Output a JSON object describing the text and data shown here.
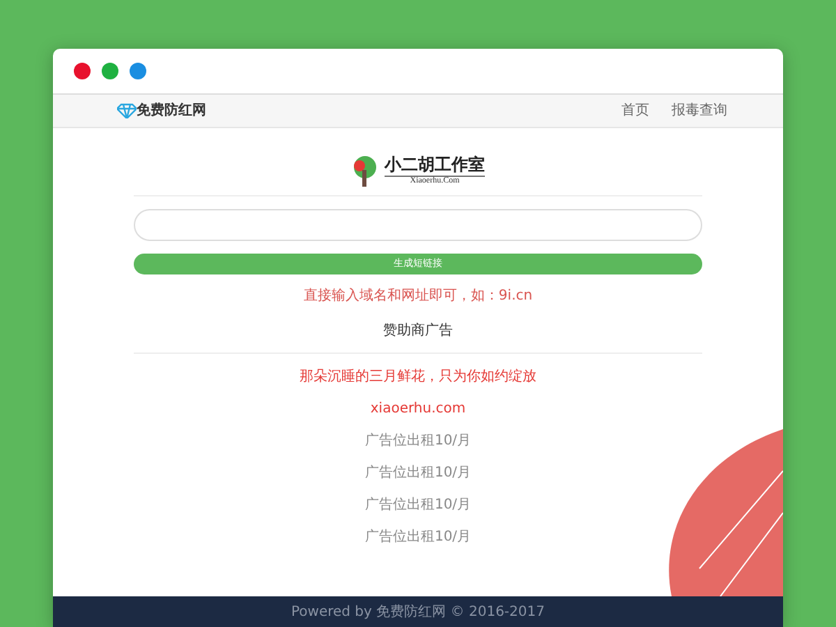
{
  "brand": {
    "name": "免费防红网"
  },
  "nav": [
    {
      "label": "首页"
    },
    {
      "label": "报毒查询"
    }
  ],
  "logo": {
    "title": "小二胡工作室",
    "subtitle": "Xiaoerhu.Com"
  },
  "generate_button": {
    "label": "生成短链接"
  },
  "hint": "直接输入域名和网址即可，如：9i.cn",
  "sponsor_heading": "赞助商广告",
  "ads": [
    {
      "kind": "slogan",
      "text": "那朵沉睡的三月鲜花，只为你如约绽放"
    },
    {
      "kind": "link",
      "text": "xiaoerhu.com"
    },
    {
      "kind": "plain",
      "text": "广告位出租10/月"
    },
    {
      "kind": "plain",
      "text": "广告位出租10/月"
    },
    {
      "kind": "plain",
      "text": "广告位出租10/月"
    },
    {
      "kind": "plain",
      "text": "广告位出租10/月"
    }
  ],
  "footer": "Powered by 免费防红网 © 2016-2017"
}
